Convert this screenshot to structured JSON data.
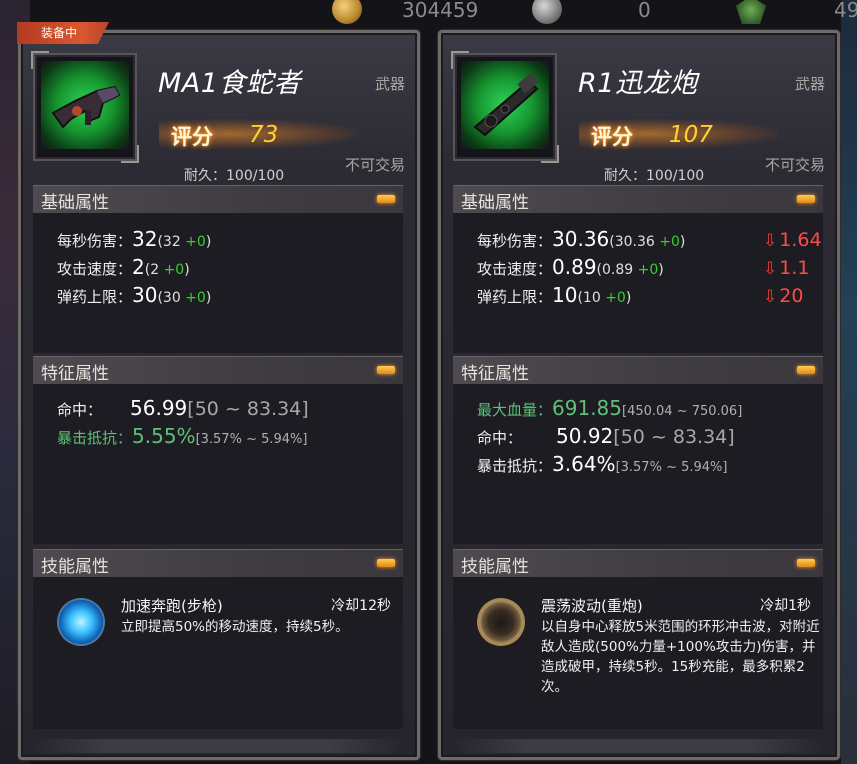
{
  "topbar": {
    "gold_amount": "304459",
    "silver_amount": "0",
    "medal_amount": "49"
  },
  "equipped_tag": "装备中",
  "left": {
    "name": "MA1食蛇者",
    "type": "武器",
    "score_label": "评分",
    "score": "73",
    "durability": "耐久：100/100",
    "tradable": "不可交易",
    "base_section": "基础属性",
    "base_stats": [
      {
        "label": "每秒伤害：",
        "value": "32",
        "base_open": "(32 ",
        "plus": "+0",
        "base_close": ")"
      },
      {
        "label": "攻击速度：",
        "value": "2",
        "base_open": "(2 ",
        "plus": "+0",
        "base_close": ")"
      },
      {
        "label": "弹药上限：",
        "value": "30",
        "base_open": "(30 ",
        "plus": "+0",
        "base_close": ")"
      }
    ],
    "feature_section": "特征属性",
    "features": [
      {
        "label": "命中：",
        "value": "56.99",
        "range": "[50 ~ 83.34]"
      },
      {
        "label": "暴击抵抗：",
        "value": "5.55%",
        "range": "[3.57% ~ 5.94%]"
      }
    ],
    "skill_section": "技能属性",
    "skill": {
      "name": "加速奔跑(步枪)",
      "cooldown": "冷却12秒",
      "desc": "立即提高50%的移动速度，持续5秒。"
    }
  },
  "right": {
    "name": "R1迅龙炮",
    "type": "武器",
    "score_label": "评分",
    "score": "107",
    "durability": "耐久：100/100",
    "tradable": "不可交易",
    "base_section": "基础属性",
    "base_stats": [
      {
        "label": "每秒伤害：",
        "value": "30.36",
        "base_open": "(30.36 ",
        "plus": "+0",
        "base_close": ")",
        "diff": "1.64"
      },
      {
        "label": "攻击速度：",
        "value": "0.89",
        "base_open": "(0.89 ",
        "plus": "+0",
        "base_close": ")",
        "diff": "1.1"
      },
      {
        "label": "弹药上限：",
        "value": "10",
        "base_open": "(10 ",
        "plus": "+0",
        "base_close": ")",
        "diff": "20"
      }
    ],
    "feature_section": "特征属性",
    "features": [
      {
        "label": "最大血量：",
        "value": "691.85",
        "range": "[450.04 ~ 750.06]"
      },
      {
        "label": "命中：",
        "value": "50.92",
        "range": "[50 ~ 83.34]"
      },
      {
        "label": "暴击抵抗：",
        "value": "3.64%",
        "range": "[3.57% ~ 5.94%]"
      }
    ],
    "skill_section": "技能属性",
    "skill": {
      "name": "震荡波动(重炮)",
      "cooldown": "冷却1秒",
      "desc": "以自身中心释放5米范围的环形冲击波，对附近敌人造成(500%力量+100%攻击力)伤害，并造成破甲，持续5秒。15秒充能，最多积累2次。"
    }
  },
  "colors": {
    "stat_plus": "#36d02f",
    "stat_down": "#ff4a4a",
    "score": "#ffd22c",
    "feature_highlight": "#5fc078"
  }
}
